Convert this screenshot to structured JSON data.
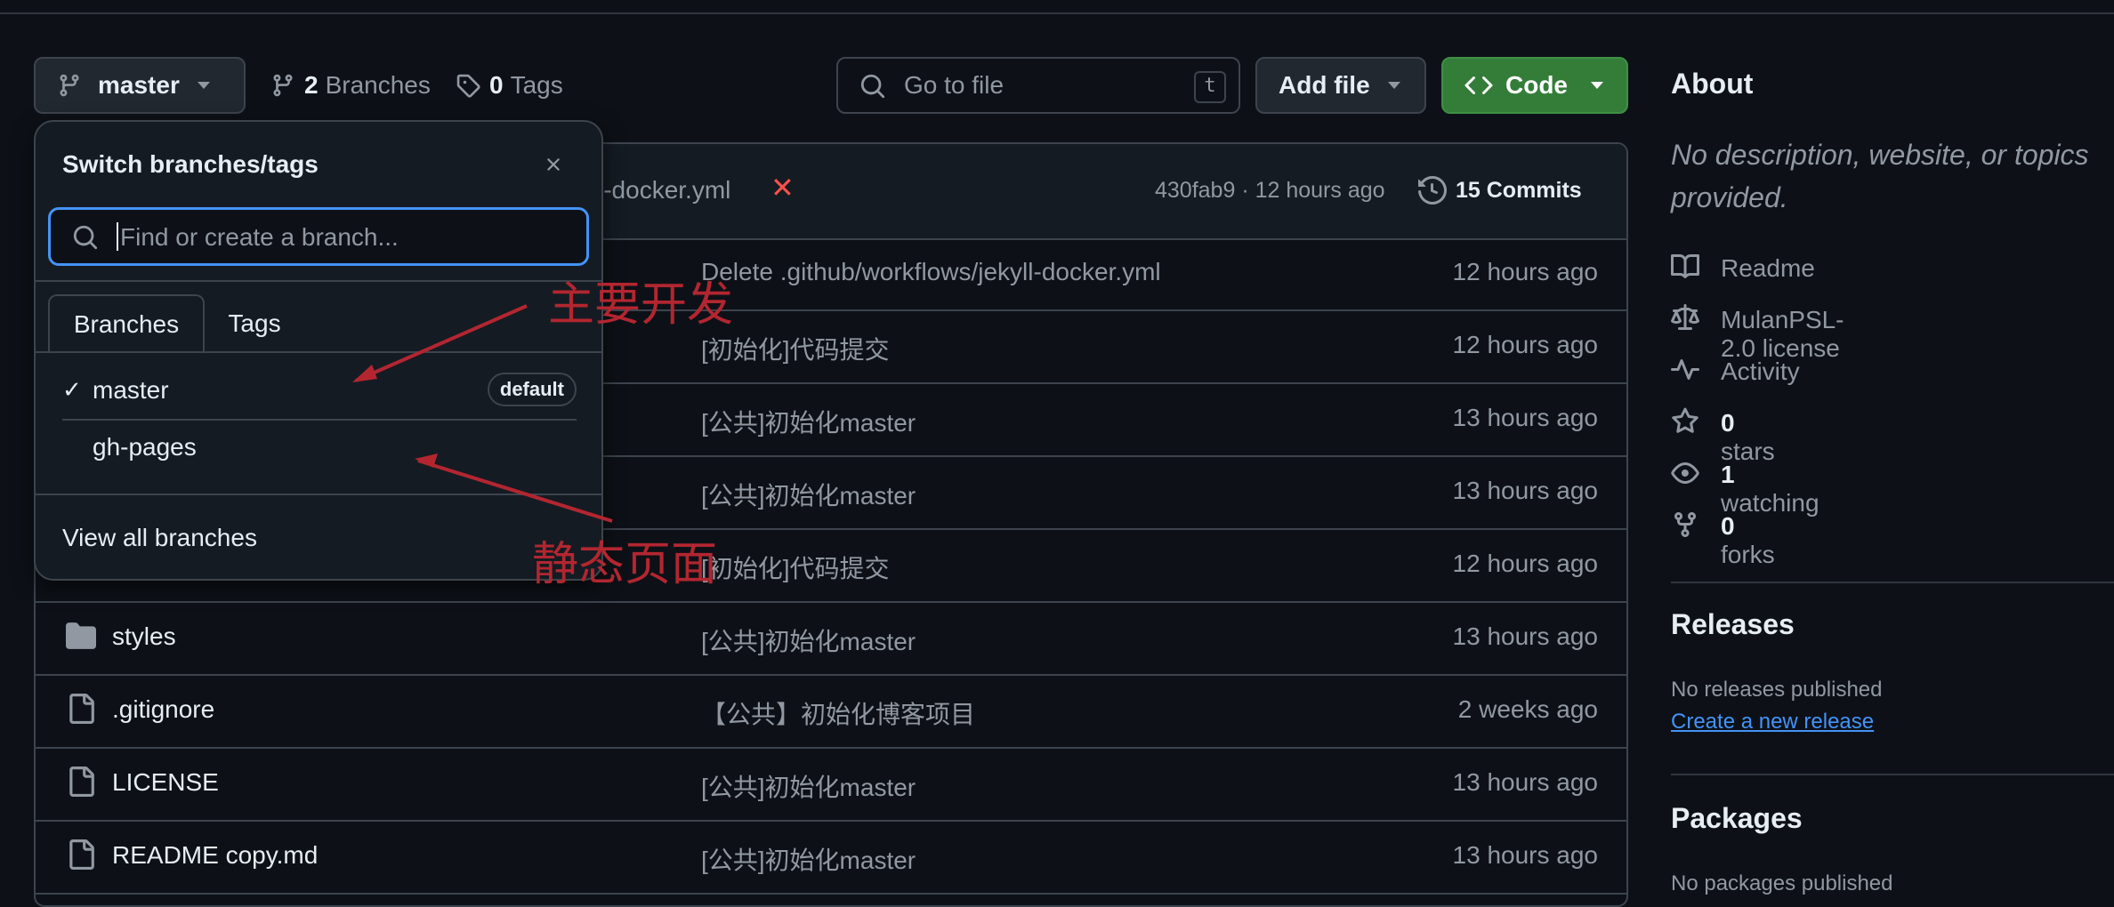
{
  "branch_button": {
    "label": "master"
  },
  "branches_link": {
    "count": "2",
    "label": "Branches"
  },
  "tags_link": {
    "count": "0",
    "label": "Tags"
  },
  "go_to_file": {
    "placeholder": "Go to file",
    "shortcut": "t"
  },
  "add_file": {
    "label": "Add file"
  },
  "code_button": {
    "label": "Code"
  },
  "commit_bar": {
    "message": "l-docker.yml",
    "hash_time": "430fab9 · 12 hours ago",
    "commits_label": "15 Commits"
  },
  "files": [
    {
      "name": "",
      "type": "",
      "message": "Delete .github/workflows/jekyll-docker.yml",
      "time": "12 hours ago"
    },
    {
      "name": "",
      "type": "",
      "message": "[初始化]代码提交",
      "time": "12 hours ago"
    },
    {
      "name": "",
      "type": "",
      "message": "[公共]初始化master",
      "time": "13 hours ago"
    },
    {
      "name": "",
      "type": "",
      "message": "[公共]初始化master",
      "time": "13 hours ago"
    },
    {
      "name": "",
      "type": "",
      "message": "[初始化]代码提交",
      "time": "12 hours ago"
    },
    {
      "name": "styles",
      "type": "folder",
      "message": "[公共]初始化master",
      "time": "13 hours ago"
    },
    {
      "name": ".gitignore",
      "type": "file",
      "message": "【公共】初始化博客项目",
      "time": "2 weeks ago"
    },
    {
      "name": "LICENSE",
      "type": "file",
      "message": "[公共]初始化master",
      "time": "13 hours ago"
    },
    {
      "name": "README copy.md",
      "type": "file",
      "message": "[公共]初始化master",
      "time": "13 hours ago"
    }
  ],
  "dropdown": {
    "title": "Switch branches/tags",
    "search_placeholder": "Find or create a branch...",
    "tabs": [
      "Branches",
      "Tags"
    ],
    "branches": [
      {
        "name": "master",
        "checked": true,
        "badge": "default"
      },
      {
        "name": "gh-pages",
        "checked": false,
        "badge": ""
      }
    ],
    "footer": "View all branches"
  },
  "annotations": {
    "main_dev": "主要开发",
    "static_pages": "静态页面"
  },
  "about": {
    "heading": "About",
    "description": "No description, website, or topics provided.",
    "readme": "Readme",
    "license": "MulanPSL-2.0 license",
    "activity": "Activity",
    "stars_count": "0",
    "stars_label": "stars",
    "watching_count": "1",
    "watching_label": "watching",
    "forks_count": "0",
    "forks_label": "forks"
  },
  "releases": {
    "heading": "Releases",
    "none": "No releases published",
    "create": "Create a new release"
  },
  "packages": {
    "heading": "Packages",
    "none": "No packages published"
  },
  "colors": {
    "bg": "#0d1117",
    "accent_green": "#347d39",
    "link_blue": "#4493f8",
    "annotation_red": "#b32630",
    "focus_blue": "#4493f8"
  }
}
